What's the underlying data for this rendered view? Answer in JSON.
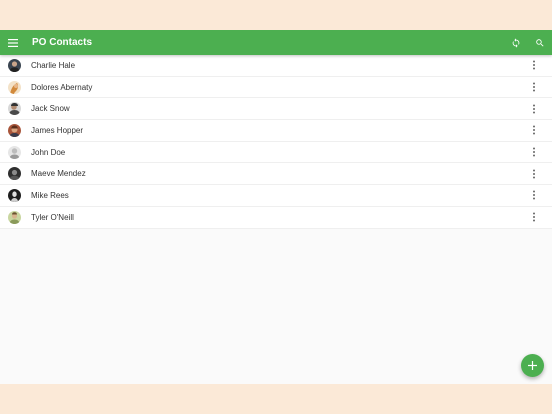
{
  "appbar": {
    "title": "PO Contacts",
    "menu_icon": "menu-icon",
    "actions": [
      "sync-icon",
      "search-icon"
    ]
  },
  "contacts": [
    {
      "name": "Charlie Hale",
      "avatar_color": "#3a4450"
    },
    {
      "name": "Dolores Abernaty",
      "avatar_color": "#d28a3c"
    },
    {
      "name": "Jack Snow",
      "avatar_color": "#4a4a4a"
    },
    {
      "name": "James Hopper",
      "avatar_color": "#a8553a"
    },
    {
      "name": "John Doe",
      "avatar_color": "#9a9a9a"
    },
    {
      "name": "Maeve Mendez",
      "avatar_color": "#2f2f2f"
    },
    {
      "name": "Mike Rees",
      "avatar_color": "#1e1e1e"
    },
    {
      "name": "Tyler O'Neill",
      "avatar_color": "#8a9a5a"
    }
  ],
  "fab": {
    "icon": "add-icon"
  },
  "colors": {
    "primary": "#4caf50",
    "background": "#fbe9d7",
    "surface": "#fafafa"
  }
}
